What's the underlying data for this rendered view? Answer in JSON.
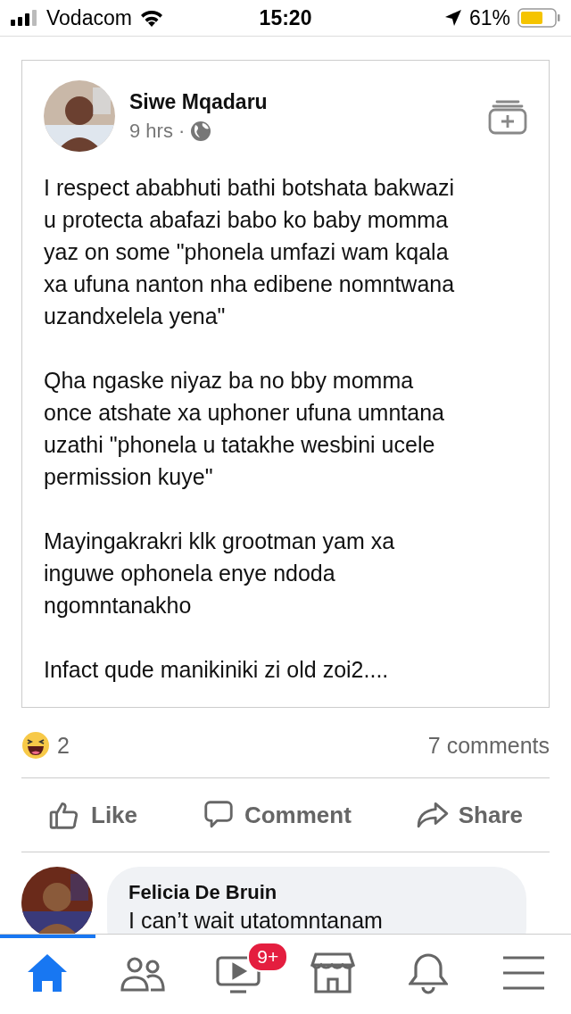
{
  "status_bar": {
    "carrier": "Vodacom",
    "time": "15:20",
    "battery": "61%"
  },
  "post": {
    "author": "Siwe Mqadaru",
    "time": "9 hrs",
    "separator": "·",
    "paragraphs": [
      "I respect ababhuti bathi botshata bakwazi\nu protecta abafazi babo ko baby momma\nyaz on some \"phonela umfazi wam kqala\nxa ufuna nanton nha edibene nomntwana\nuzandxelela yena\"",
      "Qha ngaske niyaz ba no bby momma\nonce atshate xa uphoner ufuna umntana\nuzathi \"phonela u tatakhe wesbini ucele\npermission kuye\"",
      "Mayingakrakri klk grootman yam xa\ninguwe ophonela enye ndoda\nngomntanakho",
      "Infact qude manikiniki zi old zoi2...."
    ]
  },
  "reactions": {
    "count": "2",
    "comments": "7 comments"
  },
  "actions": [
    {
      "kind": "like",
      "label": "Like"
    },
    {
      "kind": "comment",
      "label": "Comment"
    },
    {
      "kind": "share",
      "label": "Share"
    }
  ],
  "comment": {
    "author": "Felicia De Bruin",
    "text": "I can’t wait utatomntanam"
  },
  "nav": [
    {
      "kind": "home",
      "selected": true
    },
    {
      "kind": "friends",
      "selected": false
    },
    {
      "kind": "video",
      "selected": false,
      "badge": "9+"
    },
    {
      "kind": "marketplace",
      "selected": false
    },
    {
      "kind": "notifications",
      "selected": false
    },
    {
      "kind": "menu",
      "selected": false
    }
  ]
}
